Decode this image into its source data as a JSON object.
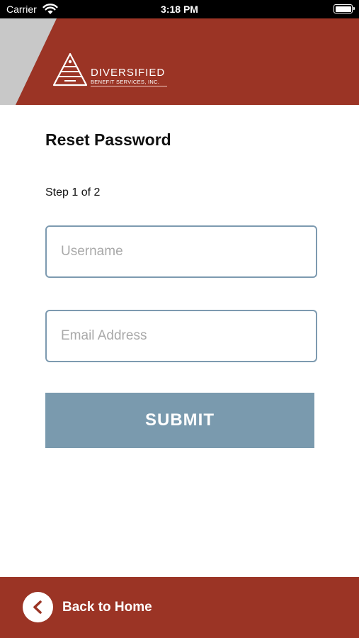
{
  "status_bar": {
    "carrier": "Carrier",
    "time": "3:18 PM",
    "icons": [
      "wifi-icon",
      "battery-icon"
    ]
  },
  "header": {
    "logo": {
      "title": "DIVERSIFIED",
      "subtitle": "BENEFIT SERVICES, INC."
    }
  },
  "form": {
    "title": "Reset Password",
    "step": "Step 1 of 2",
    "username_placeholder": "Username",
    "email_placeholder": "Email Address",
    "submit_label": "SUBMIT"
  },
  "footer": {
    "back_label": "Back to Home",
    "icon": "chevron-left-icon"
  },
  "colors": {
    "brand_red": "#9b3425",
    "header_stripe_gray": "#c8c8c8",
    "submit_button": "#7a9aae",
    "field_border": "#7d9ab0"
  }
}
